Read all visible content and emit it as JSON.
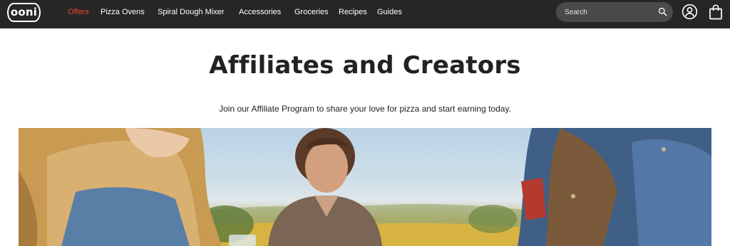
{
  "header": {
    "logo_text": "ooni",
    "nav": [
      {
        "label": "Offers",
        "active": true
      },
      {
        "label": "Pizza Ovens"
      },
      {
        "label": "Spiral Dough Mixer"
      },
      {
        "label": "Accessories"
      },
      {
        "label": "Groceries"
      },
      {
        "label": "Recipes"
      },
      {
        "label": "Guides"
      }
    ],
    "search": {
      "placeholder": "Search",
      "icon": "search-icon"
    },
    "account_icon": "account-icon",
    "cart_icon": "shopping-bag-icon"
  },
  "main": {
    "title": "Affiliates and Creators",
    "subtitle": "Join our Affiliate Program to share your love for pizza and start earning today."
  },
  "colors": {
    "header_bg": "#262626",
    "active_nav": "#e8472e",
    "text": "#222222"
  }
}
